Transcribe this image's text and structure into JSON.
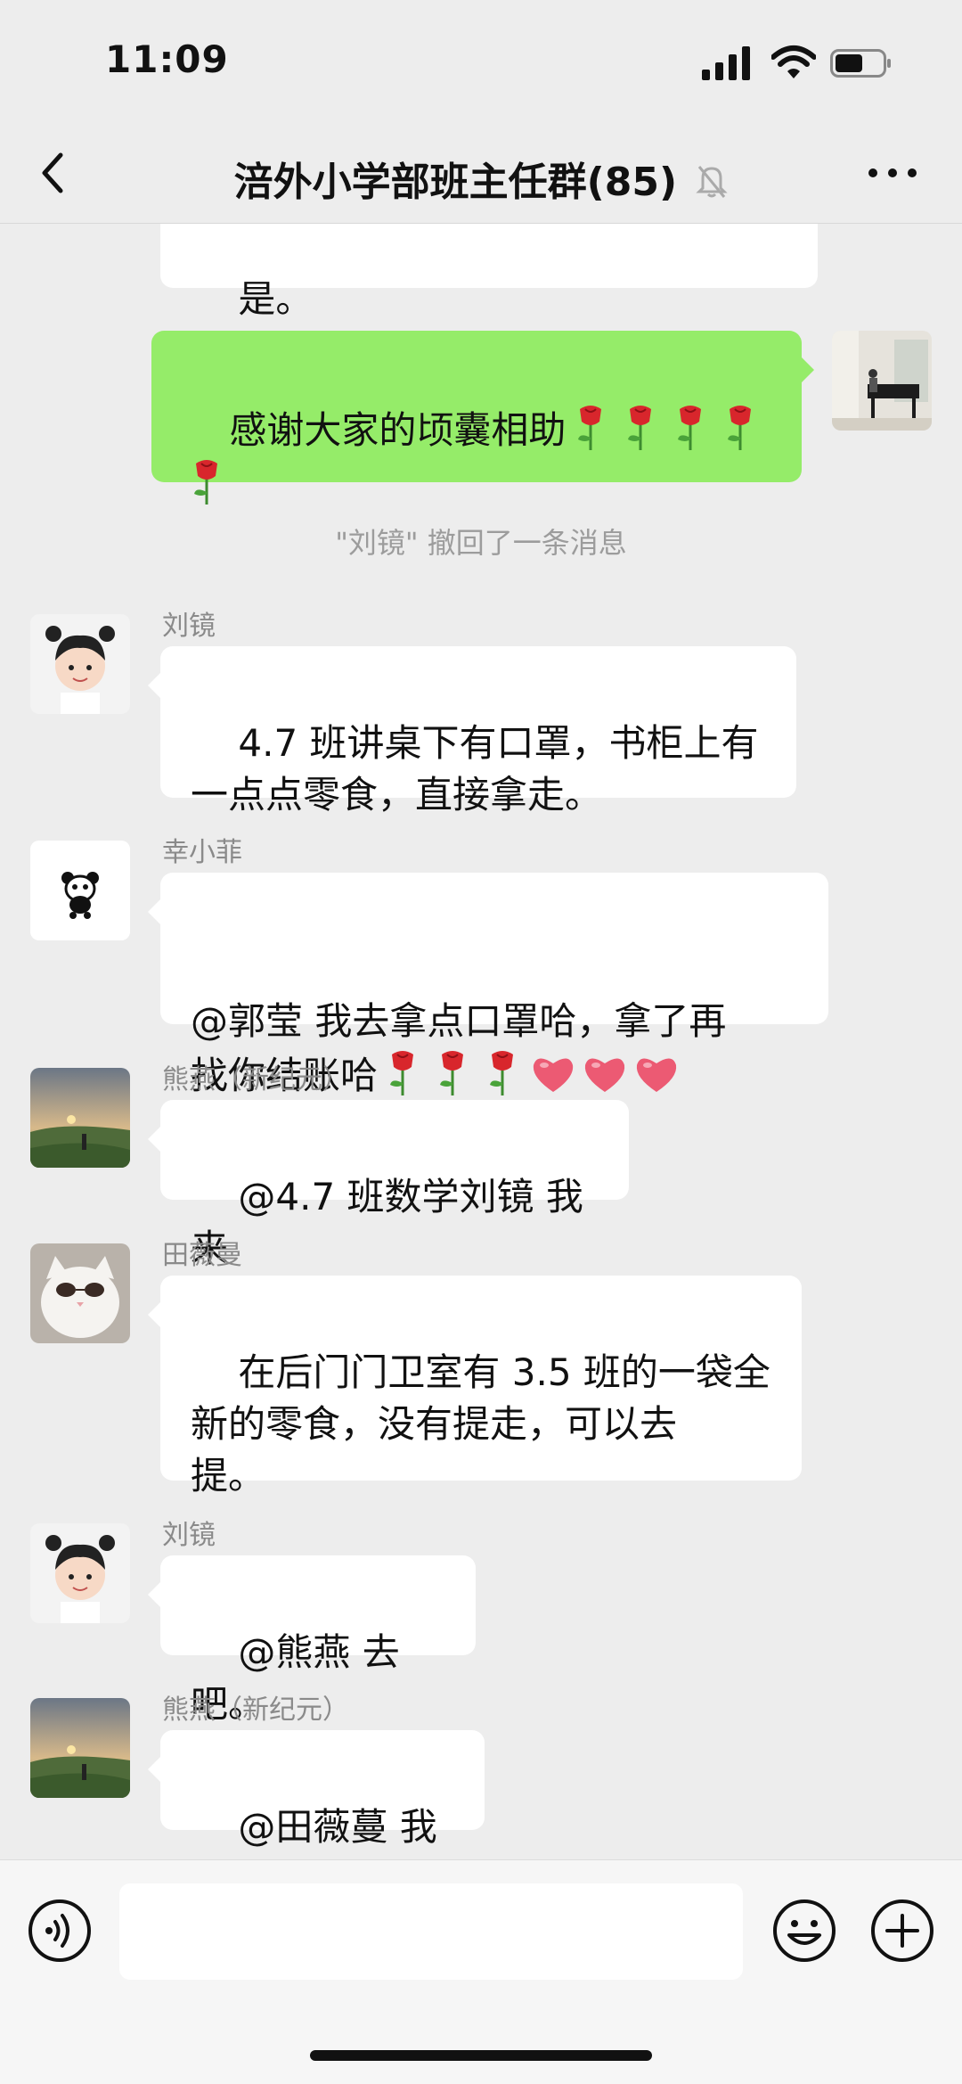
{
  "status_bar": {
    "time": "11:09"
  },
  "header": {
    "title": "涪外小学部班主任群(85)"
  },
  "messages": {
    "m0": {
      "text": "是。"
    },
    "m1": {
      "text": "感谢大家的顷囊相助"
    },
    "recall": {
      "text": "\"刘镜\" 撤回了一条消息"
    },
    "m2": {
      "sender": "刘镜",
      "text": "4.7 班讲桌下有口罩，书柜上有\n一点点零食，直接拿走。"
    },
    "m3": {
      "sender": "幸小菲",
      "line1": "@郭莹 我去拿点口罩哈，拿了再",
      "line2": "找你结账哈"
    },
    "m4": {
      "sender": "熊燕（新纪元）",
      "text": "@4.7 班数学刘镜 我来"
    },
    "m5": {
      "sender": "田薇曼",
      "text": "在后门门卫室有 3.5 班的一袋全\n新的零食，没有提走，可以去\n提。"
    },
    "m6": {
      "sender": "刘镜",
      "text": "@熊燕 去吧。"
    },
    "m7": {
      "sender": "熊燕（新纪元）",
      "text": "@田薇蔓 我去"
    }
  },
  "icons": [
    "back-icon",
    "mute-icon",
    "more-icon",
    "voice-icon",
    "emoji-icon",
    "plus-icon",
    "rose-icon",
    "heart-icon"
  ],
  "colors": {
    "background": "#ededed",
    "my_bubble": "#95ec69",
    "other_bubble": "#ffffff",
    "meta_text": "#8a8a8a"
  }
}
